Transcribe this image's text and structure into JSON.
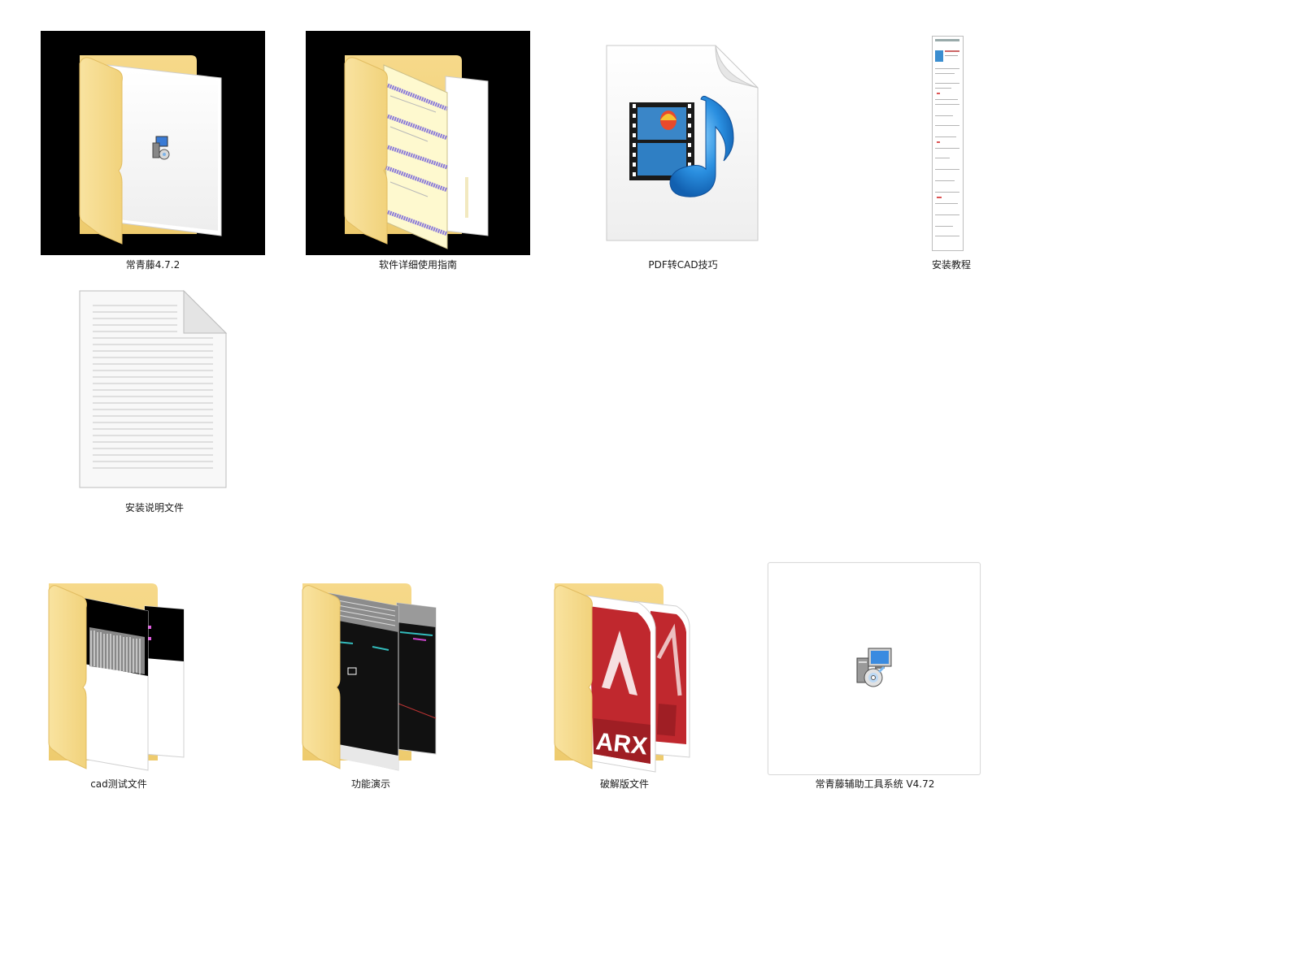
{
  "items": [
    {
      "label": "常青藤4.7.2",
      "icon": "folder-with-installer-preview-icon"
    },
    {
      "label": "软件详细使用指南",
      "icon": "folder-with-document-preview-icon"
    },
    {
      "label": "PDF转CAD技巧",
      "icon": "video-file-icon"
    },
    {
      "label": "安装教程",
      "icon": "long-document-thumbnail-icon"
    },
    {
      "label": "安装说明文件",
      "icon": "text-file-icon"
    },
    {
      "label": "cad测试文件",
      "icon": "folder-with-cad-preview-icon"
    },
    {
      "label": "功能演示",
      "icon": "folder-with-screenshot-preview-icon"
    },
    {
      "label": "破解版文件",
      "icon": "folder-with-arx-preview-icon"
    },
    {
      "label": "常青藤辅助工具系统 V4.72",
      "icon": "installer-package-icon"
    }
  ],
  "colors": {
    "folder_tan": "#f3d68b",
    "folder_light": "#fce9a8",
    "selection_black": "#000000",
    "cad_red": "#c0282e"
  },
  "texts": {
    "arx": "ARX"
  }
}
